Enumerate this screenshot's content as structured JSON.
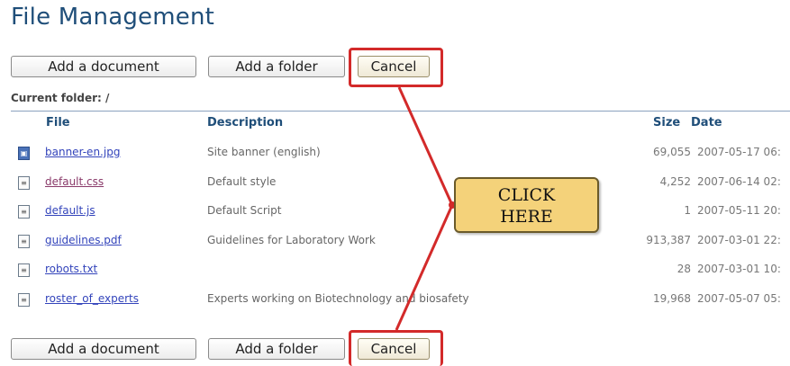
{
  "page": {
    "title": "File Management"
  },
  "toolbar_top": {
    "add_document": "Add a document",
    "add_folder": "Add a folder",
    "cancel": "Cancel"
  },
  "toolbar_bottom": {
    "add_document": "Add a document",
    "add_folder": "Add a folder",
    "cancel": "Cancel"
  },
  "current_folder": "Current folder: /",
  "table": {
    "headers": {
      "file": "File",
      "description": "Description",
      "size": "Size",
      "date": "Date"
    },
    "rows": [
      {
        "icon": "image-file-icon",
        "file": "banner-en.jpg",
        "description": "Site banner (english)",
        "size": "69,055",
        "date": "2007-05-17 06:"
      },
      {
        "icon": "css-file-icon",
        "file": "default.css",
        "description": "Default style",
        "size": "4,252",
        "date": "2007-06-14 02:"
      },
      {
        "icon": "js-file-icon",
        "file": "default.js",
        "description": "Default Script",
        "size": "1",
        "date": "2007-05-11 20:"
      },
      {
        "icon": "pdf-file-icon",
        "file": "guidelines.pdf",
        "description": "Guidelines for Laboratory Work",
        "size": "913,387",
        "date": "2007-03-01 22:"
      },
      {
        "icon": "text-file-icon",
        "file": "robots.txt",
        "description": "",
        "size": "28",
        "date": "2007-03-01 10:"
      },
      {
        "icon": "document-file-icon",
        "file": "roster_of_experts",
        "description": "Experts working on Biotechnology and biosafety",
        "size": "19,968",
        "date": "2007-05-07 05:"
      }
    ]
  },
  "callout": {
    "line1": "CLICK",
    "line2": "HERE"
  },
  "colors": {
    "highlight": "#d32a2a",
    "callout_bg": "#f4d27a",
    "title": "#1f4e79",
    "link": "#3344bb"
  }
}
